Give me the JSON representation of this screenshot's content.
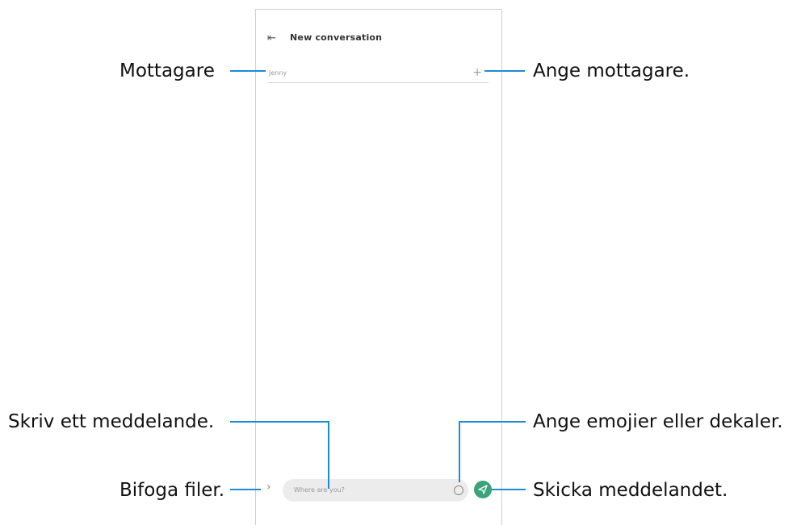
{
  "screen": {
    "header": {
      "back_icon": "back-arrow-icon",
      "title": "New conversation"
    },
    "recipient_field": {
      "value": "Jenny",
      "add_icon": "plus-icon"
    },
    "composer": {
      "attach_icon": "chevron-right-icon",
      "placeholder": "Where are you?",
      "emoji_icon": "emoji-icon",
      "send_icon": "send-icon"
    }
  },
  "callouts": {
    "recipient": "Mottagare",
    "add_recipient": "Ange mottagare.",
    "write_message": "Skriv ett meddelande.",
    "emoji_stickers": "Ange emojier eller dekaler.",
    "attach_files": "Bifoga filer.",
    "send_message": "Skicka meddelandet."
  },
  "colors": {
    "callout_line": "#1e8bd6",
    "send_button": "#3aa37a"
  }
}
